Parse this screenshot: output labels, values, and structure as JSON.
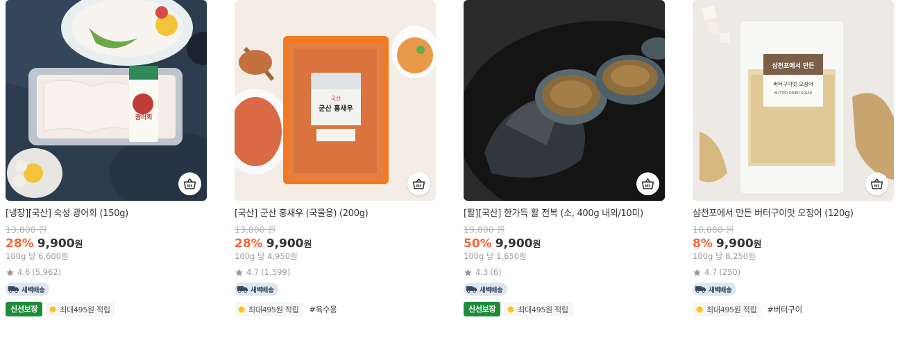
{
  "products": [
    {
      "title": "[냉장][국산] 숙성 광어회 (150g)",
      "original_price": "13,800 원",
      "discount": "28%",
      "price": "9,900",
      "won": "원",
      "unit_price": "100g 당 6,600원",
      "rating": "4.6",
      "review_count": "(5,962)",
      "dawn_delivery": "새벽배송",
      "fresh_badge": "신선보장",
      "point_badge": "최대495원 적립",
      "hashtag": "",
      "package_label": "광어회"
    },
    {
      "title": "[국산] 군산 홍새우 (국물용) (200g)",
      "original_price": "13,800 원",
      "discount": "28%",
      "price": "9,900",
      "won": "원",
      "unit_price": "100g 당 4,950원",
      "rating": "4.7",
      "review_count": "(1,599)",
      "dawn_delivery": "새벽배송",
      "fresh_badge": "",
      "point_badge": "최대495원 적립",
      "hashtag": "#육수용",
      "package_label": "군산 홍새우",
      "package_label_small": "국산"
    },
    {
      "title": "[활][국산] 한가득 활 전복 (소, 400g 내외/10미)",
      "original_price": "19,800 원",
      "discount": "50%",
      "price": "9,900",
      "won": "원",
      "unit_price": "100g 당 1,650원",
      "rating": "4.3",
      "review_count": "(6)",
      "dawn_delivery": "새벽배송",
      "fresh_badge": "신선보장",
      "point_badge": "최대495원 적립",
      "hashtag": ""
    },
    {
      "title": "삼천포에서 만든 버터구이맛 오징어 (120g)",
      "original_price": "10,800 원",
      "discount": "8%",
      "price": "9,900",
      "won": "원",
      "unit_price": "100g 당 8,250원",
      "rating": "4.7",
      "review_count": "(250)",
      "dawn_delivery": "새벽배송",
      "fresh_badge": "",
      "point_badge": "최대495원 적립",
      "hashtag": "#버터구이",
      "package_label": "삼천포에서 만든",
      "package_label_sub": "버터구이맛 오징어",
      "package_label_en": "BUTTER DRIED SQUID"
    }
  ],
  "icons": {
    "cart": "basket-icon",
    "star": "star-icon",
    "dawn": "truck-icon",
    "point": "coin-icon"
  },
  "colors": {
    "discount": "#fa622f",
    "fresh_badge": "#1d8b3a",
    "dawn_badge_bg": "#dfe6ee",
    "coin": "#ffc21e"
  }
}
